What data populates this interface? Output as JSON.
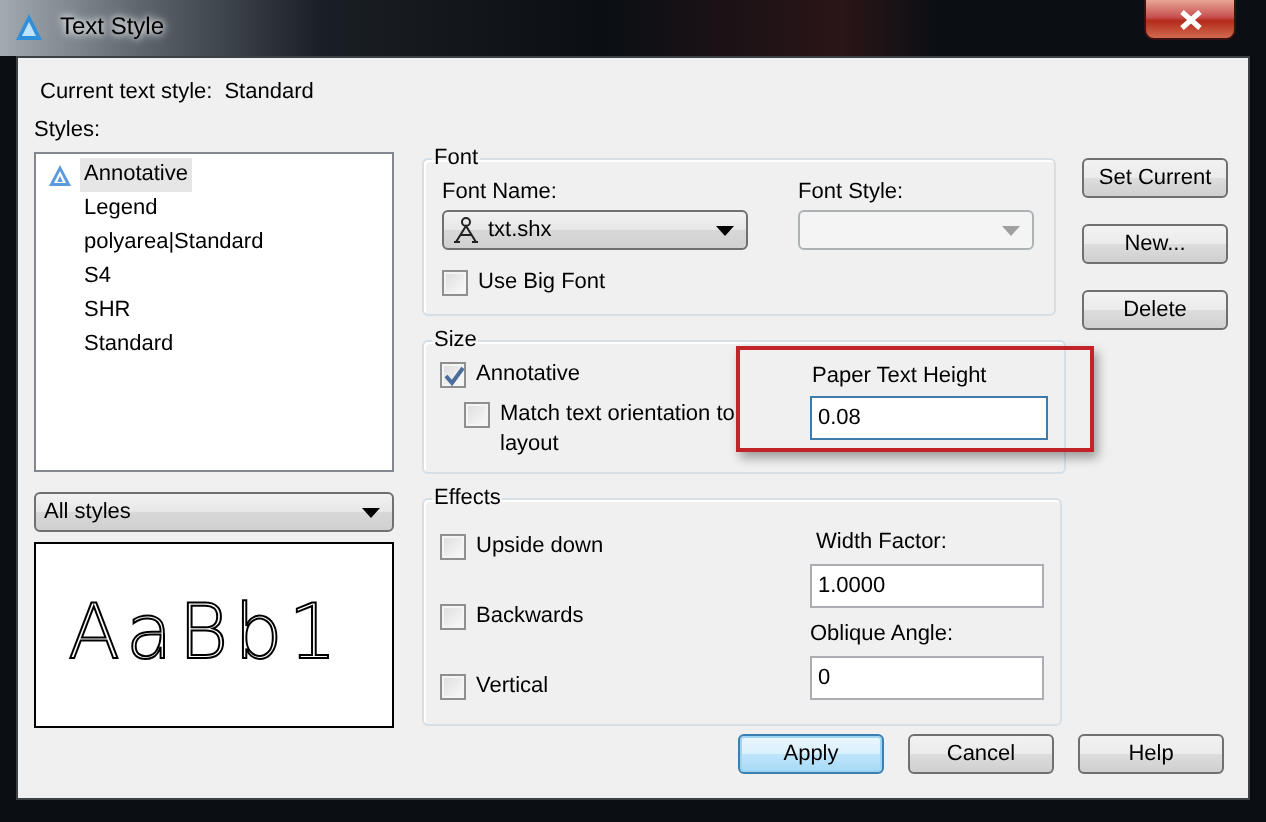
{
  "window": {
    "title": "Text Style"
  },
  "current_style": {
    "label": "Current text style:",
    "value": "Standard"
  },
  "styles": {
    "label": "Styles:",
    "items": [
      {
        "name": "Annotative",
        "annotative": true,
        "selected": true
      },
      {
        "name": "Legend",
        "annotative": false,
        "selected": false
      },
      {
        "name": "polyarea|Standard",
        "annotative": false,
        "selected": false
      },
      {
        "name": "S4",
        "annotative": false,
        "selected": false
      },
      {
        "name": "SHR",
        "annotative": false,
        "selected": false
      },
      {
        "name": "Standard",
        "annotative": false,
        "selected": false
      }
    ]
  },
  "filter": {
    "value": "All styles"
  },
  "preview": {
    "text": "AaBb1"
  },
  "font": {
    "title": "Font",
    "font_name": {
      "label": "Font Name:",
      "value": "txt.shx"
    },
    "font_style": {
      "label": "Font Style:",
      "disabled": true
    },
    "use_big_font": {
      "label": "Use Big Font",
      "checked": false
    }
  },
  "size": {
    "title": "Size",
    "annotative": {
      "label": "Annotative",
      "checked": true
    },
    "match_orientation": {
      "label": "Match text orientation to layout",
      "checked": false
    },
    "paper_text_height": {
      "label": "Paper Text Height",
      "value": "0.08",
      "highlighted": true
    }
  },
  "effects": {
    "title": "Effects",
    "checks": [
      {
        "label": "Upside down",
        "checked": false
      },
      {
        "label": "Backwards",
        "checked": false
      },
      {
        "label": "Vertical",
        "checked": false
      }
    ],
    "width_factor": {
      "label": "Width Factor:",
      "value": "1.0000"
    },
    "oblique_angle": {
      "label": "Oblique Angle:",
      "value": "0"
    }
  },
  "side_buttons": [
    {
      "label": "Set Current"
    },
    {
      "label": "New..."
    },
    {
      "label": "Delete"
    }
  ],
  "footer_buttons": [
    {
      "label": "Apply",
      "default": true
    },
    {
      "label": "Cancel",
      "default": false
    },
    {
      "label": "Help",
      "default": false
    }
  ]
}
